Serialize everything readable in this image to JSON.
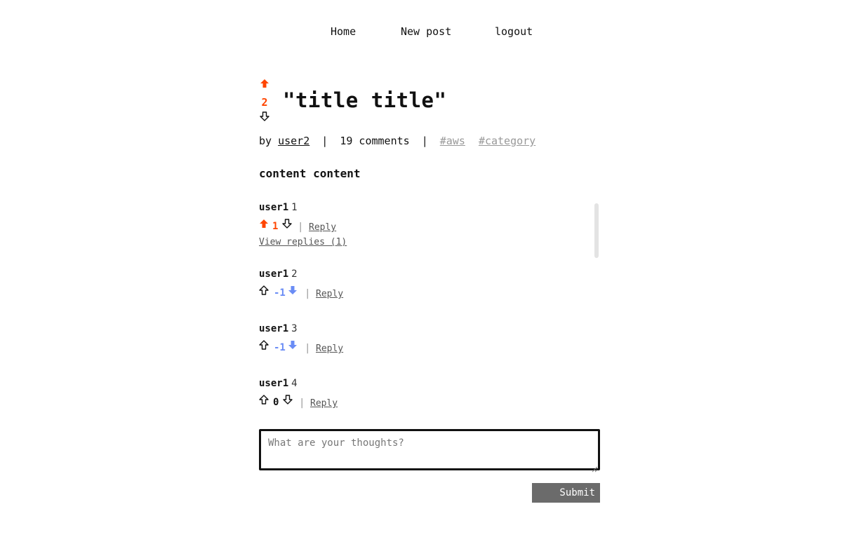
{
  "nav": {
    "home": "Home",
    "new_post": "New post",
    "logout": "logout"
  },
  "post": {
    "score": "2",
    "title": "\"title title\"",
    "by": "by",
    "author": "user2",
    "separator": "|",
    "comments_count": "19 comments",
    "tags": [
      "#aws",
      "#category"
    ],
    "content": "content content",
    "vote_state": "up"
  },
  "comments": [
    {
      "user": "user1",
      "body": "1",
      "score": "1",
      "vote_state": "up",
      "reply": "Reply",
      "view_replies": "View replies (1)"
    },
    {
      "user": "user1",
      "body": "2",
      "score": "-1",
      "vote_state": "down",
      "reply": "Reply"
    },
    {
      "user": "user1",
      "body": "3",
      "score": "-1",
      "vote_state": "down",
      "reply": "Reply"
    },
    {
      "user": "user1",
      "body": "4",
      "score": "0",
      "vote_state": "none",
      "reply": "Reply"
    }
  ],
  "reply_form": {
    "placeholder": "What are your thoughts?",
    "submit": "Submit"
  },
  "colors": {
    "upvote": "#ff4500",
    "downvote": "#6a8cf5",
    "neutral": "#111111",
    "muted": "#999999",
    "button": "#6b6b6b"
  }
}
